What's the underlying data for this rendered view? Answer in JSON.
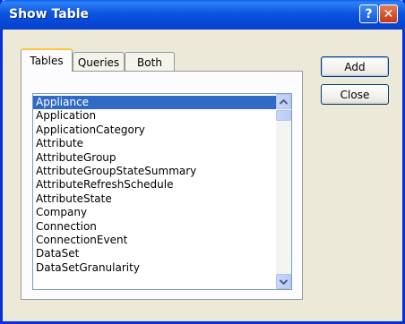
{
  "window": {
    "title": "Show Table"
  },
  "titlebar": {
    "help_label": "?",
    "close_label": "✕"
  },
  "tabs": [
    {
      "label": "Tables",
      "active": true
    },
    {
      "label": "Queries",
      "active": false
    },
    {
      "label": "Both",
      "active": false
    }
  ],
  "table_list": {
    "selected_index": 0,
    "items": [
      "Appliance",
      "Application",
      "ApplicationCategory",
      "Attribute",
      "AttributeGroup",
      "AttributeGroupStateSummary",
      "AttributeRefreshSchedule",
      "AttributeState",
      "Company",
      "Connection",
      "ConnectionEvent",
      "DataSet",
      "DataSetGranularity"
    ]
  },
  "buttons": {
    "add_label": "Add",
    "close_label": "Close"
  },
  "icons": {
    "help": "question-mark-icon",
    "close": "close-x-icon",
    "scroll_up": "chevron-up-icon",
    "scroll_down": "chevron-down-icon"
  },
  "colors": {
    "titlebar": "#0b55e0",
    "selection": "#316ac5",
    "close_button": "#c23a12",
    "dialog_bg": "#ece9d8"
  }
}
